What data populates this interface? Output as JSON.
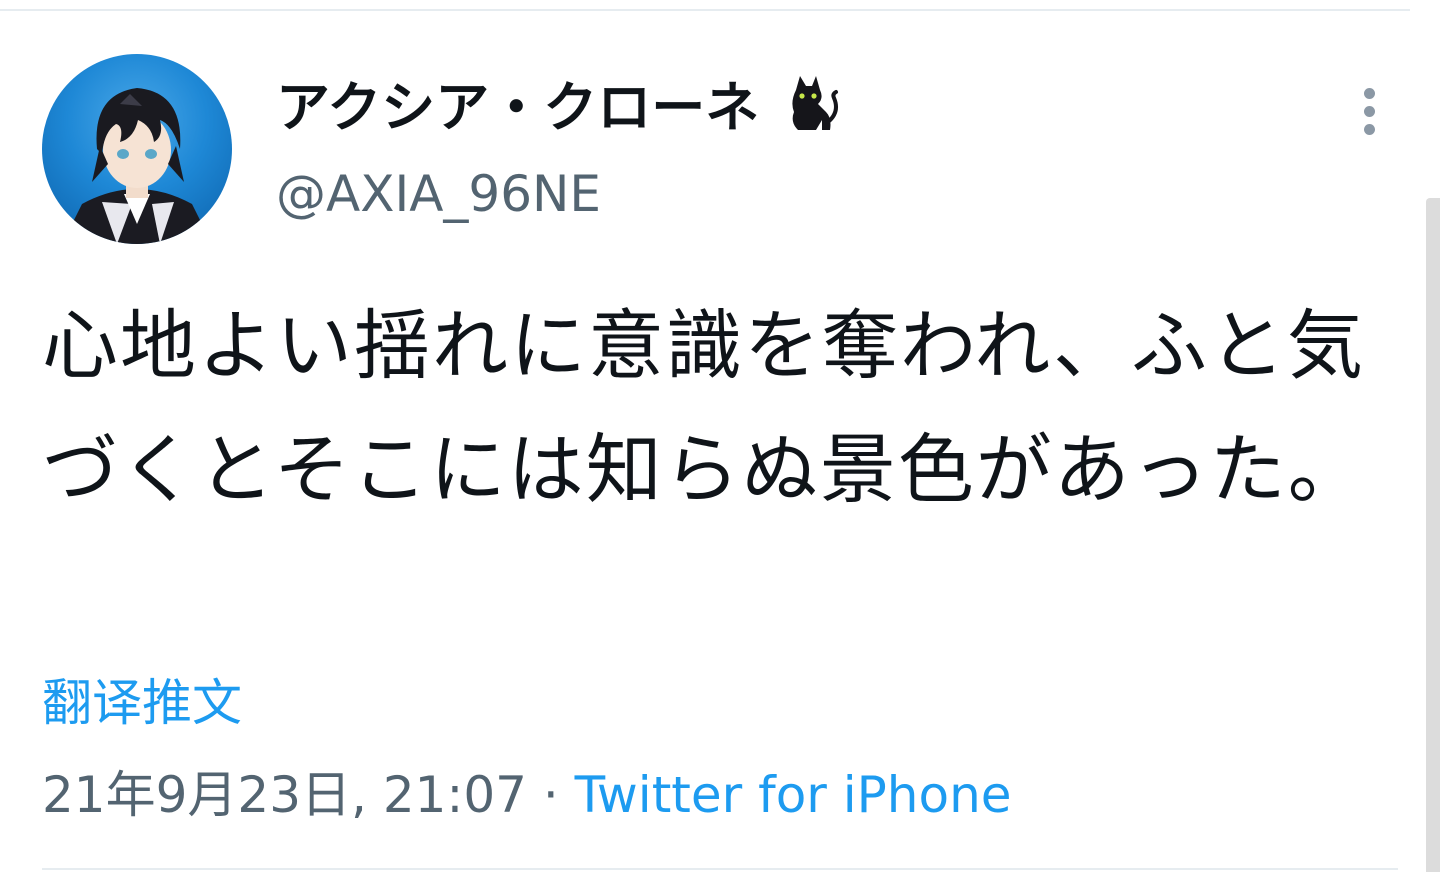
{
  "author": {
    "display_name": "アクシア・クローネ",
    "name_emoji": "black-cat-icon",
    "handle": "@AXIA_96NE"
  },
  "tweet": {
    "text": "心地よい揺れに意識を奪われ、ふと気づくとそこには知らぬ景色があった。",
    "translate_label": "翻译推文",
    "timestamp": "21年9月23日, 21:07",
    "separator": "·",
    "source": "Twitter for iPhone"
  },
  "colors": {
    "text_primary": "#0f1419",
    "text_secondary": "#536471",
    "link": "#1d9bf0",
    "divider": "#e6ecf0",
    "avatar_bg": "#1e88d6"
  }
}
